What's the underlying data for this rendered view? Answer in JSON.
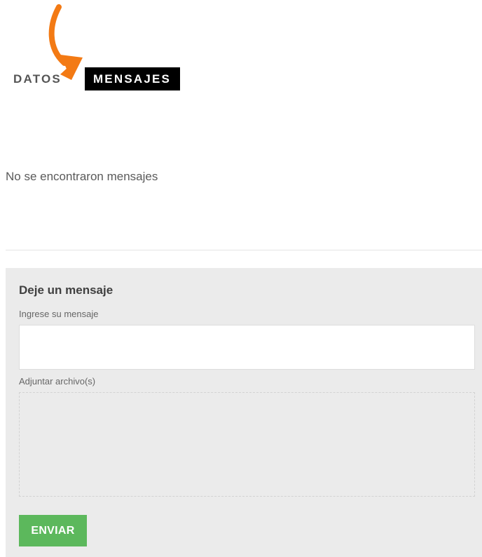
{
  "tabs": {
    "datos": "DATOS",
    "mensajes": "MENSAJES",
    "active": "mensajes"
  },
  "messages": {
    "empty_text": "No se encontraron mensajes"
  },
  "form": {
    "title": "Deje un mensaje",
    "message_label": "Ingrese su mensaje",
    "message_value": "",
    "attach_label": "Adjuntar archivo(s)",
    "submit_label": "ENVIAR"
  },
  "colors": {
    "accent_arrow": "#f37a14",
    "submit_button": "#5cb85c",
    "active_tab_bg": "#000000",
    "panel_bg": "#ebebeb"
  },
  "icons": {
    "annotation": "curved-arrow-icon"
  }
}
